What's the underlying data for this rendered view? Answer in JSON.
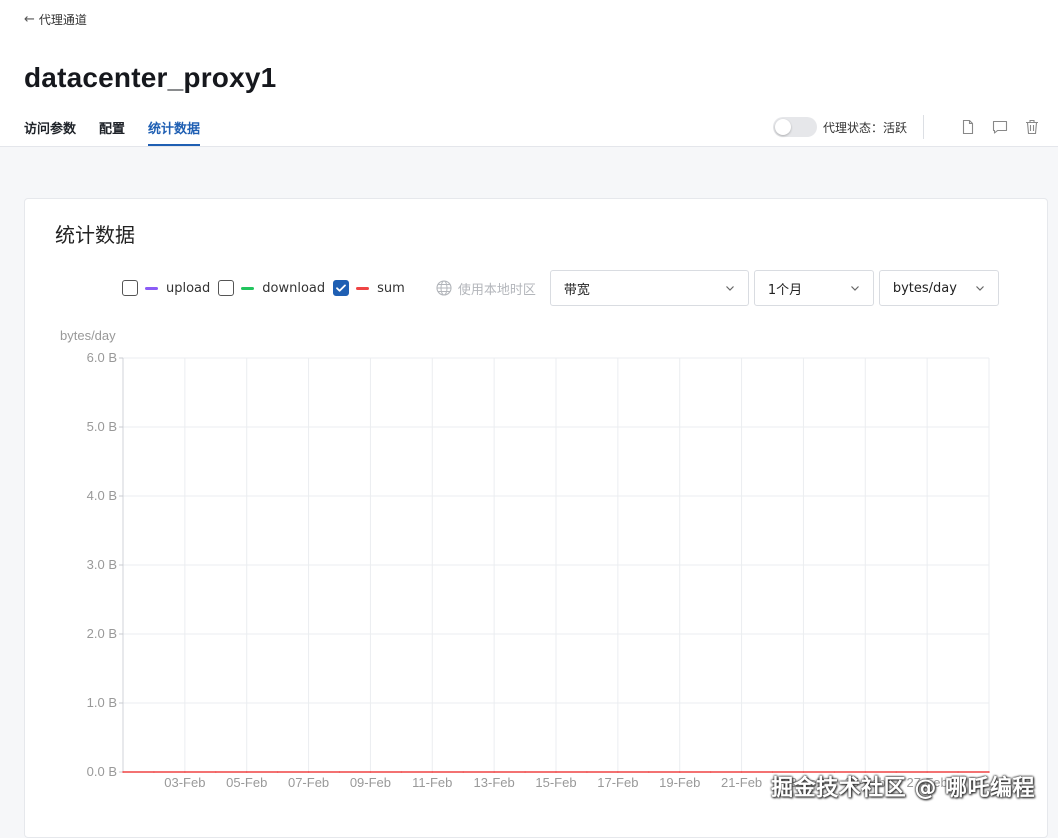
{
  "header": {
    "back_label": "代理通道",
    "title": "datacenter_proxy1",
    "tabs": [
      {
        "label": "访问参数",
        "active": false
      },
      {
        "label": "配置",
        "active": false
      },
      {
        "label": "统计数据",
        "active": true
      }
    ],
    "status_label": "代理状态：活跃",
    "toggle_on": false,
    "icons": [
      "file-icon",
      "comment-icon",
      "trash-icon"
    ]
  },
  "card": {
    "title": "统计数据",
    "legend": [
      {
        "label": "upload",
        "color": "#8b5cf6",
        "checked": false
      },
      {
        "label": "download",
        "color": "#22c55e",
        "checked": false
      },
      {
        "label": "sum",
        "color": "#ef4444",
        "checked": true
      }
    ],
    "timezone_label": "使用本地时区",
    "selects": [
      {
        "value": "带宽"
      },
      {
        "value": "1个月"
      },
      {
        "value": "bytes/day"
      }
    ]
  },
  "accent_color": "#1f5fb3",
  "chart_data": {
    "type": "line",
    "ylabel": "bytes/day",
    "ylim": [
      0,
      6
    ],
    "yticks": [
      "0.0 B",
      "1.0 B",
      "2.0 B",
      "3.0 B",
      "4.0 B",
      "5.0 B",
      "6.0 B"
    ],
    "x": [
      "01-Feb",
      "02-Feb",
      "03-Feb",
      "04-Feb",
      "05-Feb",
      "06-Feb",
      "07-Feb",
      "08-Feb",
      "09-Feb",
      "10-Feb",
      "11-Feb",
      "12-Feb",
      "13-Feb",
      "14-Feb",
      "15-Feb",
      "16-Feb",
      "17-Feb",
      "18-Feb",
      "19-Feb",
      "20-Feb",
      "21-Feb",
      "22-Feb",
      "23-Feb",
      "24-Feb",
      "25-Feb",
      "26-Feb",
      "27-Feb",
      "28-Feb",
      "29-Feb"
    ],
    "xtick_labels": [
      "03-Feb",
      "05-Feb",
      "07-Feb",
      "09-Feb",
      "11-Feb",
      "13-Feb",
      "15-Feb",
      "17-Feb",
      "19-Feb",
      "21-Feb",
      "23-Feb",
      "25-Feb",
      "27-Feb"
    ],
    "series": [
      {
        "name": "sum",
        "color": "#ef4444",
        "values": [
          0,
          0,
          0,
          0,
          0,
          0,
          0,
          0,
          0,
          0,
          0,
          0,
          0,
          0,
          0,
          0,
          0,
          0,
          0,
          0,
          0,
          0,
          0,
          0,
          0,
          0,
          0,
          0,
          0
        ]
      }
    ],
    "grid": true
  },
  "watermark": "掘金技术社区 @ 哪吒编程"
}
